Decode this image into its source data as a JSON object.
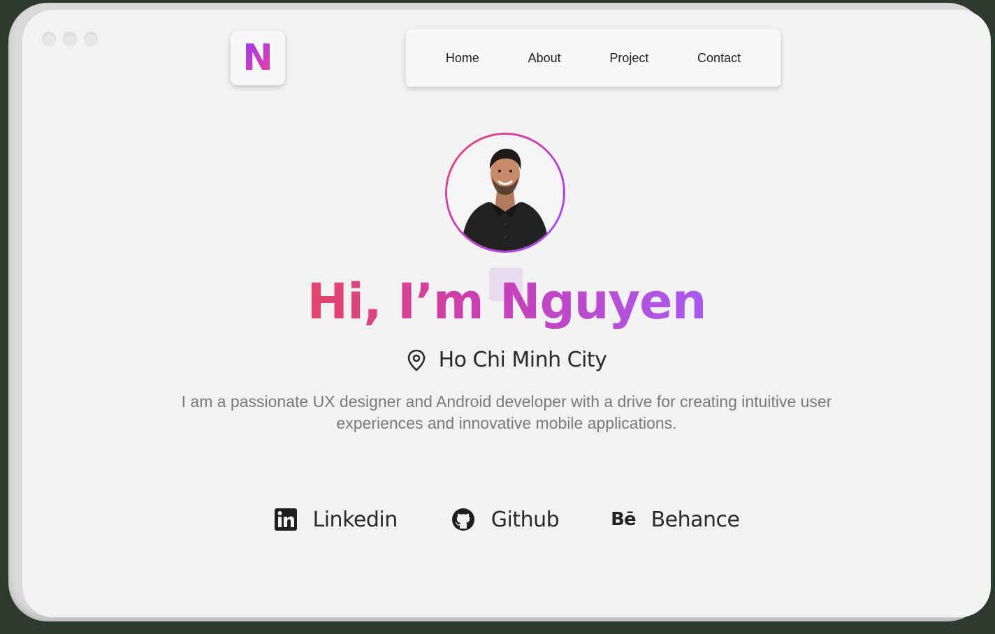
{
  "window": {
    "controls": [
      "close",
      "minimize",
      "maximize"
    ]
  },
  "logo": {
    "letter": "N"
  },
  "nav": {
    "items": [
      {
        "label": "Home"
      },
      {
        "label": "About"
      },
      {
        "label": "Project"
      },
      {
        "label": "Contact"
      }
    ]
  },
  "hero": {
    "avatar_alt": "profile photo",
    "greeting": "Hi, I’m Nguyen",
    "location": "Ho Chi Minh City",
    "location_icon": "map-pin-icon",
    "bio": "I am a passionate UX designer and Android developer with a drive for creating intuitive user experiences and innovative mobile applications."
  },
  "socials": [
    {
      "label": "Linkedin",
      "icon": "linkedin-icon"
    },
    {
      "label": "Github",
      "icon": "github-icon"
    },
    {
      "label": "Behance",
      "icon": "behance-icon",
      "icon_text": "Bē"
    }
  ],
  "colors": {
    "gradient_start": "#e3456b",
    "gradient_mid": "#c93fb4",
    "gradient_end": "#a85af0",
    "background": "#f2f2f2",
    "text": "#2a2a2a",
    "muted_text": "#7a7a7a"
  }
}
